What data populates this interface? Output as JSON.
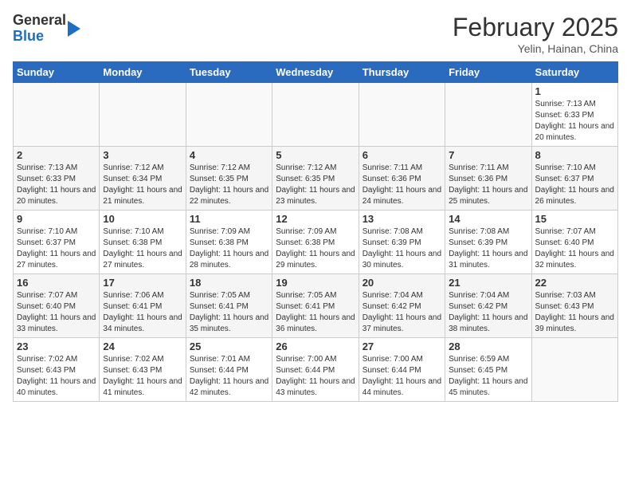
{
  "header": {
    "logo_general": "General",
    "logo_blue": "Blue",
    "month_title": "February 2025",
    "subtitle": "Yelin, Hainan, China"
  },
  "weekdays": [
    "Sunday",
    "Monday",
    "Tuesday",
    "Wednesday",
    "Thursday",
    "Friday",
    "Saturday"
  ],
  "weeks": [
    [
      {
        "day": "",
        "info": ""
      },
      {
        "day": "",
        "info": ""
      },
      {
        "day": "",
        "info": ""
      },
      {
        "day": "",
        "info": ""
      },
      {
        "day": "",
        "info": ""
      },
      {
        "day": "",
        "info": ""
      },
      {
        "day": "1",
        "info": "Sunrise: 7:13 AM\nSunset: 6:33 PM\nDaylight: 11 hours and 20 minutes."
      }
    ],
    [
      {
        "day": "2",
        "info": "Sunrise: 7:13 AM\nSunset: 6:33 PM\nDaylight: 11 hours and 20 minutes."
      },
      {
        "day": "3",
        "info": "Sunrise: 7:12 AM\nSunset: 6:34 PM\nDaylight: 11 hours and 21 minutes."
      },
      {
        "day": "4",
        "info": "Sunrise: 7:12 AM\nSunset: 6:35 PM\nDaylight: 11 hours and 22 minutes."
      },
      {
        "day": "5",
        "info": "Sunrise: 7:12 AM\nSunset: 6:35 PM\nDaylight: 11 hours and 23 minutes."
      },
      {
        "day": "6",
        "info": "Sunrise: 7:11 AM\nSunset: 6:36 PM\nDaylight: 11 hours and 24 minutes."
      },
      {
        "day": "7",
        "info": "Sunrise: 7:11 AM\nSunset: 6:36 PM\nDaylight: 11 hours and 25 minutes."
      },
      {
        "day": "8",
        "info": "Sunrise: 7:10 AM\nSunset: 6:37 PM\nDaylight: 11 hours and 26 minutes."
      }
    ],
    [
      {
        "day": "9",
        "info": "Sunrise: 7:10 AM\nSunset: 6:37 PM\nDaylight: 11 hours and 27 minutes."
      },
      {
        "day": "10",
        "info": "Sunrise: 7:10 AM\nSunset: 6:38 PM\nDaylight: 11 hours and 27 minutes."
      },
      {
        "day": "11",
        "info": "Sunrise: 7:09 AM\nSunset: 6:38 PM\nDaylight: 11 hours and 28 minutes."
      },
      {
        "day": "12",
        "info": "Sunrise: 7:09 AM\nSunset: 6:38 PM\nDaylight: 11 hours and 29 minutes."
      },
      {
        "day": "13",
        "info": "Sunrise: 7:08 AM\nSunset: 6:39 PM\nDaylight: 11 hours and 30 minutes."
      },
      {
        "day": "14",
        "info": "Sunrise: 7:08 AM\nSunset: 6:39 PM\nDaylight: 11 hours and 31 minutes."
      },
      {
        "day": "15",
        "info": "Sunrise: 7:07 AM\nSunset: 6:40 PM\nDaylight: 11 hours and 32 minutes."
      }
    ],
    [
      {
        "day": "16",
        "info": "Sunrise: 7:07 AM\nSunset: 6:40 PM\nDaylight: 11 hours and 33 minutes."
      },
      {
        "day": "17",
        "info": "Sunrise: 7:06 AM\nSunset: 6:41 PM\nDaylight: 11 hours and 34 minutes."
      },
      {
        "day": "18",
        "info": "Sunrise: 7:05 AM\nSunset: 6:41 PM\nDaylight: 11 hours and 35 minutes."
      },
      {
        "day": "19",
        "info": "Sunrise: 7:05 AM\nSunset: 6:41 PM\nDaylight: 11 hours and 36 minutes."
      },
      {
        "day": "20",
        "info": "Sunrise: 7:04 AM\nSunset: 6:42 PM\nDaylight: 11 hours and 37 minutes."
      },
      {
        "day": "21",
        "info": "Sunrise: 7:04 AM\nSunset: 6:42 PM\nDaylight: 11 hours and 38 minutes."
      },
      {
        "day": "22",
        "info": "Sunrise: 7:03 AM\nSunset: 6:43 PM\nDaylight: 11 hours and 39 minutes."
      }
    ],
    [
      {
        "day": "23",
        "info": "Sunrise: 7:02 AM\nSunset: 6:43 PM\nDaylight: 11 hours and 40 minutes."
      },
      {
        "day": "24",
        "info": "Sunrise: 7:02 AM\nSunset: 6:43 PM\nDaylight: 11 hours and 41 minutes."
      },
      {
        "day": "25",
        "info": "Sunrise: 7:01 AM\nSunset: 6:44 PM\nDaylight: 11 hours and 42 minutes."
      },
      {
        "day": "26",
        "info": "Sunrise: 7:00 AM\nSunset: 6:44 PM\nDaylight: 11 hours and 43 minutes."
      },
      {
        "day": "27",
        "info": "Sunrise: 7:00 AM\nSunset: 6:44 PM\nDaylight: 11 hours and 44 minutes."
      },
      {
        "day": "28",
        "info": "Sunrise: 6:59 AM\nSunset: 6:45 PM\nDaylight: 11 hours and 45 minutes."
      },
      {
        "day": "",
        "info": ""
      }
    ]
  ]
}
